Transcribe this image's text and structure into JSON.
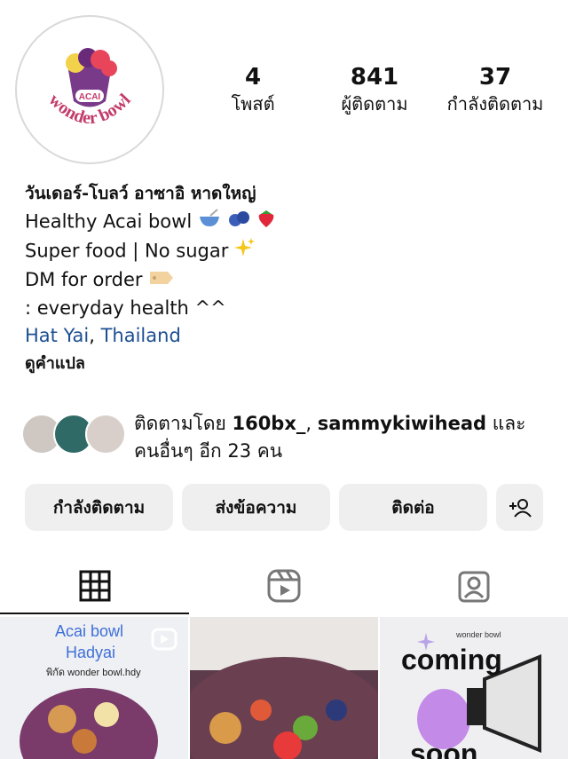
{
  "profile": {
    "avatar_text": "wonder bowl",
    "avatar_badge": "ACAI",
    "stats": [
      {
        "value": "4",
        "label": "โพสต์"
      },
      {
        "value": "841",
        "label": "ผู้ติดตาม"
      },
      {
        "value": "37",
        "label": "กำลังติดตาม"
      }
    ],
    "display_name": "วันเดอร์-โบลว์ อาซาอิ หาดใหญ่",
    "bio_lines": [
      "Healthy Acai bowl",
      "Super food | No sugar",
      "DM for order",
      ": everyday health ^^"
    ],
    "location_city": "Hat Yai",
    "location_sep": ",",
    "location_country": "Thailand",
    "see_translation": "ดูคำแปล"
  },
  "followed_by": {
    "prefix": "ติดตามโดย",
    "user1": "160bx_",
    "sep": ",",
    "user2": "sammykiwihead",
    "suffix": "และ",
    "others": "คนอื่นๆ อีก 23 คน"
  },
  "actions": {
    "following_label": "กำลังติดตาม",
    "message_label": "ส่งข้อความ",
    "contact_label": "ติดต่อ"
  },
  "tabs": [
    "grid-icon",
    "reels-icon",
    "tagged-icon"
  ],
  "posts": [
    {
      "title_line1": "Acai bowl",
      "title_line2": "Hadyai",
      "caption": "พิกัด wonder bowl.hdy"
    },
    {
      "title_line1": ""
    },
    {
      "brand": "wonder bowl",
      "headline": "coming",
      "headline2": "soon"
    }
  ],
  "colors": {
    "link": "#1d4f91",
    "button_bg": "#efefef",
    "accent_pink": "#c23b6a"
  }
}
